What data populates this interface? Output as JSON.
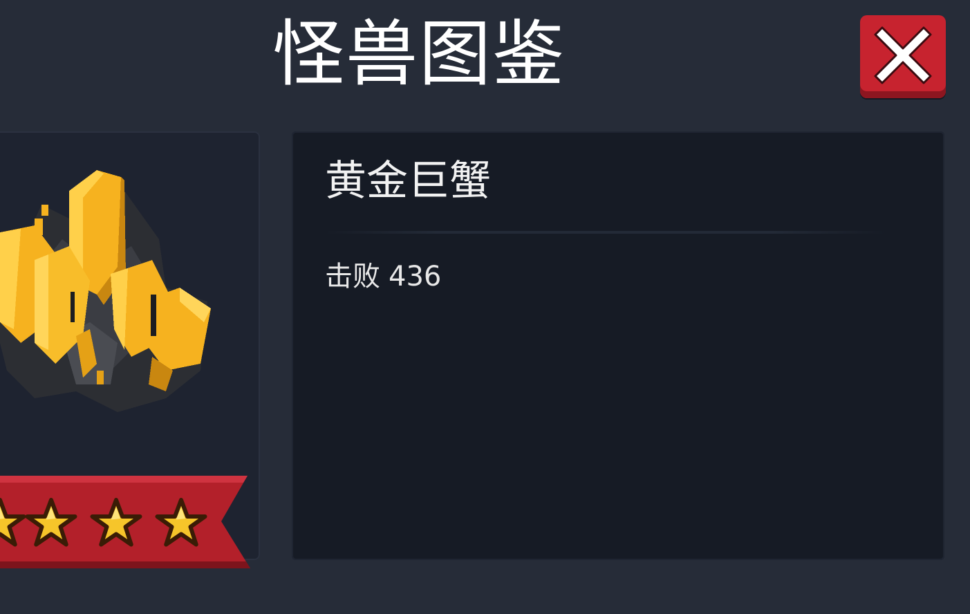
{
  "header": {
    "title": "怪兽图鉴",
    "close_icon": "close-x-icon"
  },
  "monster": {
    "name": "黄金巨蟹",
    "defeat_label": "击败",
    "defeat_count": "436",
    "art_icon": "golden-crystal-crab-sprite",
    "rating_stars": 4
  },
  "colors": {
    "background": "#262c38",
    "info_panel": "#161b25",
    "close_button": "#c7232f",
    "ribbon": "#b3202a",
    "gold": "#f6b21f"
  }
}
